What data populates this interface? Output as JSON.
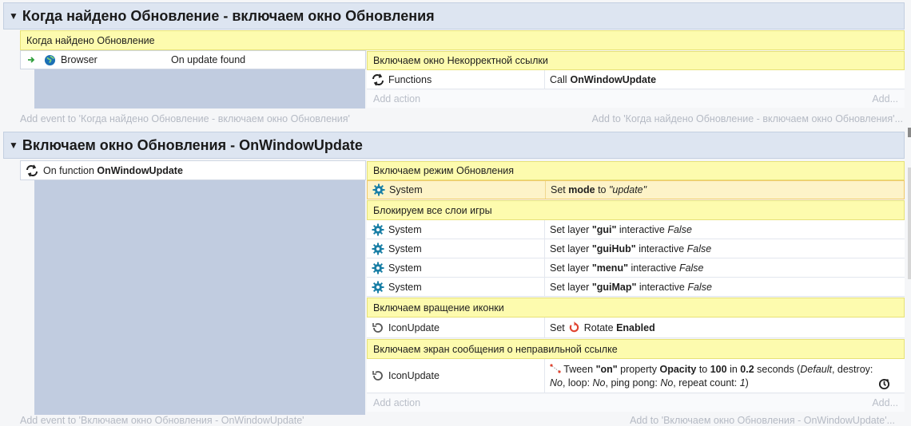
{
  "groups": [
    {
      "title": "Когда найдено Обновление - включаем окно Обновления",
      "comment": "Когда найдено Обновление",
      "condition": {
        "object": "Browser",
        "text": "On update found"
      },
      "action_comment": "Включаем окно Некорректной ссылки",
      "actions": [
        {
          "object": "Functions",
          "text_prefix": "Call ",
          "text_bold": "OnWindowUpdate"
        }
      ],
      "add_action": "Add action",
      "add_action_right": "Add...",
      "add_event": "Add event to 'Когда найдено Обновление - включаем окно Обновления'",
      "add_to": "Add to 'Когда найдено Обновление - включаем окно Обновления'..."
    },
    {
      "title": "Включаем окно Обновления - OnWindowUpdate",
      "condition": {
        "prefix": "On function ",
        "bold": "OnWindowUpdate"
      },
      "comment_mode": "Включаем режим Обновления",
      "mode_action": {
        "object": "System",
        "t1": "Set ",
        "b1": "mode",
        "t2": " to ",
        "i1": "\"update\""
      },
      "comment_layers": "Блокируем все слои игры",
      "layer_actions": [
        {
          "object": "System",
          "t1": "Set layer ",
          "b1": "\"gui\"",
          "t2": " interactive ",
          "i1": "False"
        },
        {
          "object": "System",
          "t1": "Set layer ",
          "b1": "\"guiHub\"",
          "t2": " interactive ",
          "i1": "False"
        },
        {
          "object": "System",
          "t1": "Set layer ",
          "b1": "\"menu\"",
          "t2": " interactive ",
          "i1": "False"
        },
        {
          "object": "System",
          "t1": "Set layer ",
          "b1": "\"guiMap\"",
          "t2": " interactive ",
          "i1": "False"
        }
      ],
      "comment_rotate": "Включаем вращение иконки",
      "rotate_action": {
        "object": "IconUpdate",
        "t1": "Set ",
        "t2": "Rotate ",
        "b1": "Enabled"
      },
      "comment_screen": "Включаем экран сообщения о неправильной ссылке",
      "tween_action": {
        "object": "IconUpdate",
        "line1": {
          "t1": "Tween ",
          "b1": "\"on\"",
          "t2": " property ",
          "b2": "Opacity",
          "t3": " to ",
          "b3": "100",
          "t4": " in ",
          "b4": "0.2",
          "t5": " seconds (",
          "i1": "Default",
          "t6": ", destroy:"
        },
        "line2": {
          "i1": "No",
          "t1": ", loop: ",
          "i2": "No",
          "t2": ", ping pong: ",
          "i3": "No",
          "t3": ", repeat count: ",
          "i4": "1",
          "t4": ")"
        }
      },
      "add_action": "Add action",
      "add_action_right": "Add...",
      "add_event": "Add event to 'Включаем окно Обновления - OnWindowUpdate'",
      "add_to": "Add to 'Включаем окно Обновления - OnWindowUpdate'..."
    }
  ],
  "colors": {
    "comment": "#fdfbae",
    "header": "#dde5f1",
    "condition_panel": "#c1cce0",
    "selected": "#fdf3c8",
    "gear": "#1a7fa6",
    "green_arrow": "#2e9e3a"
  }
}
